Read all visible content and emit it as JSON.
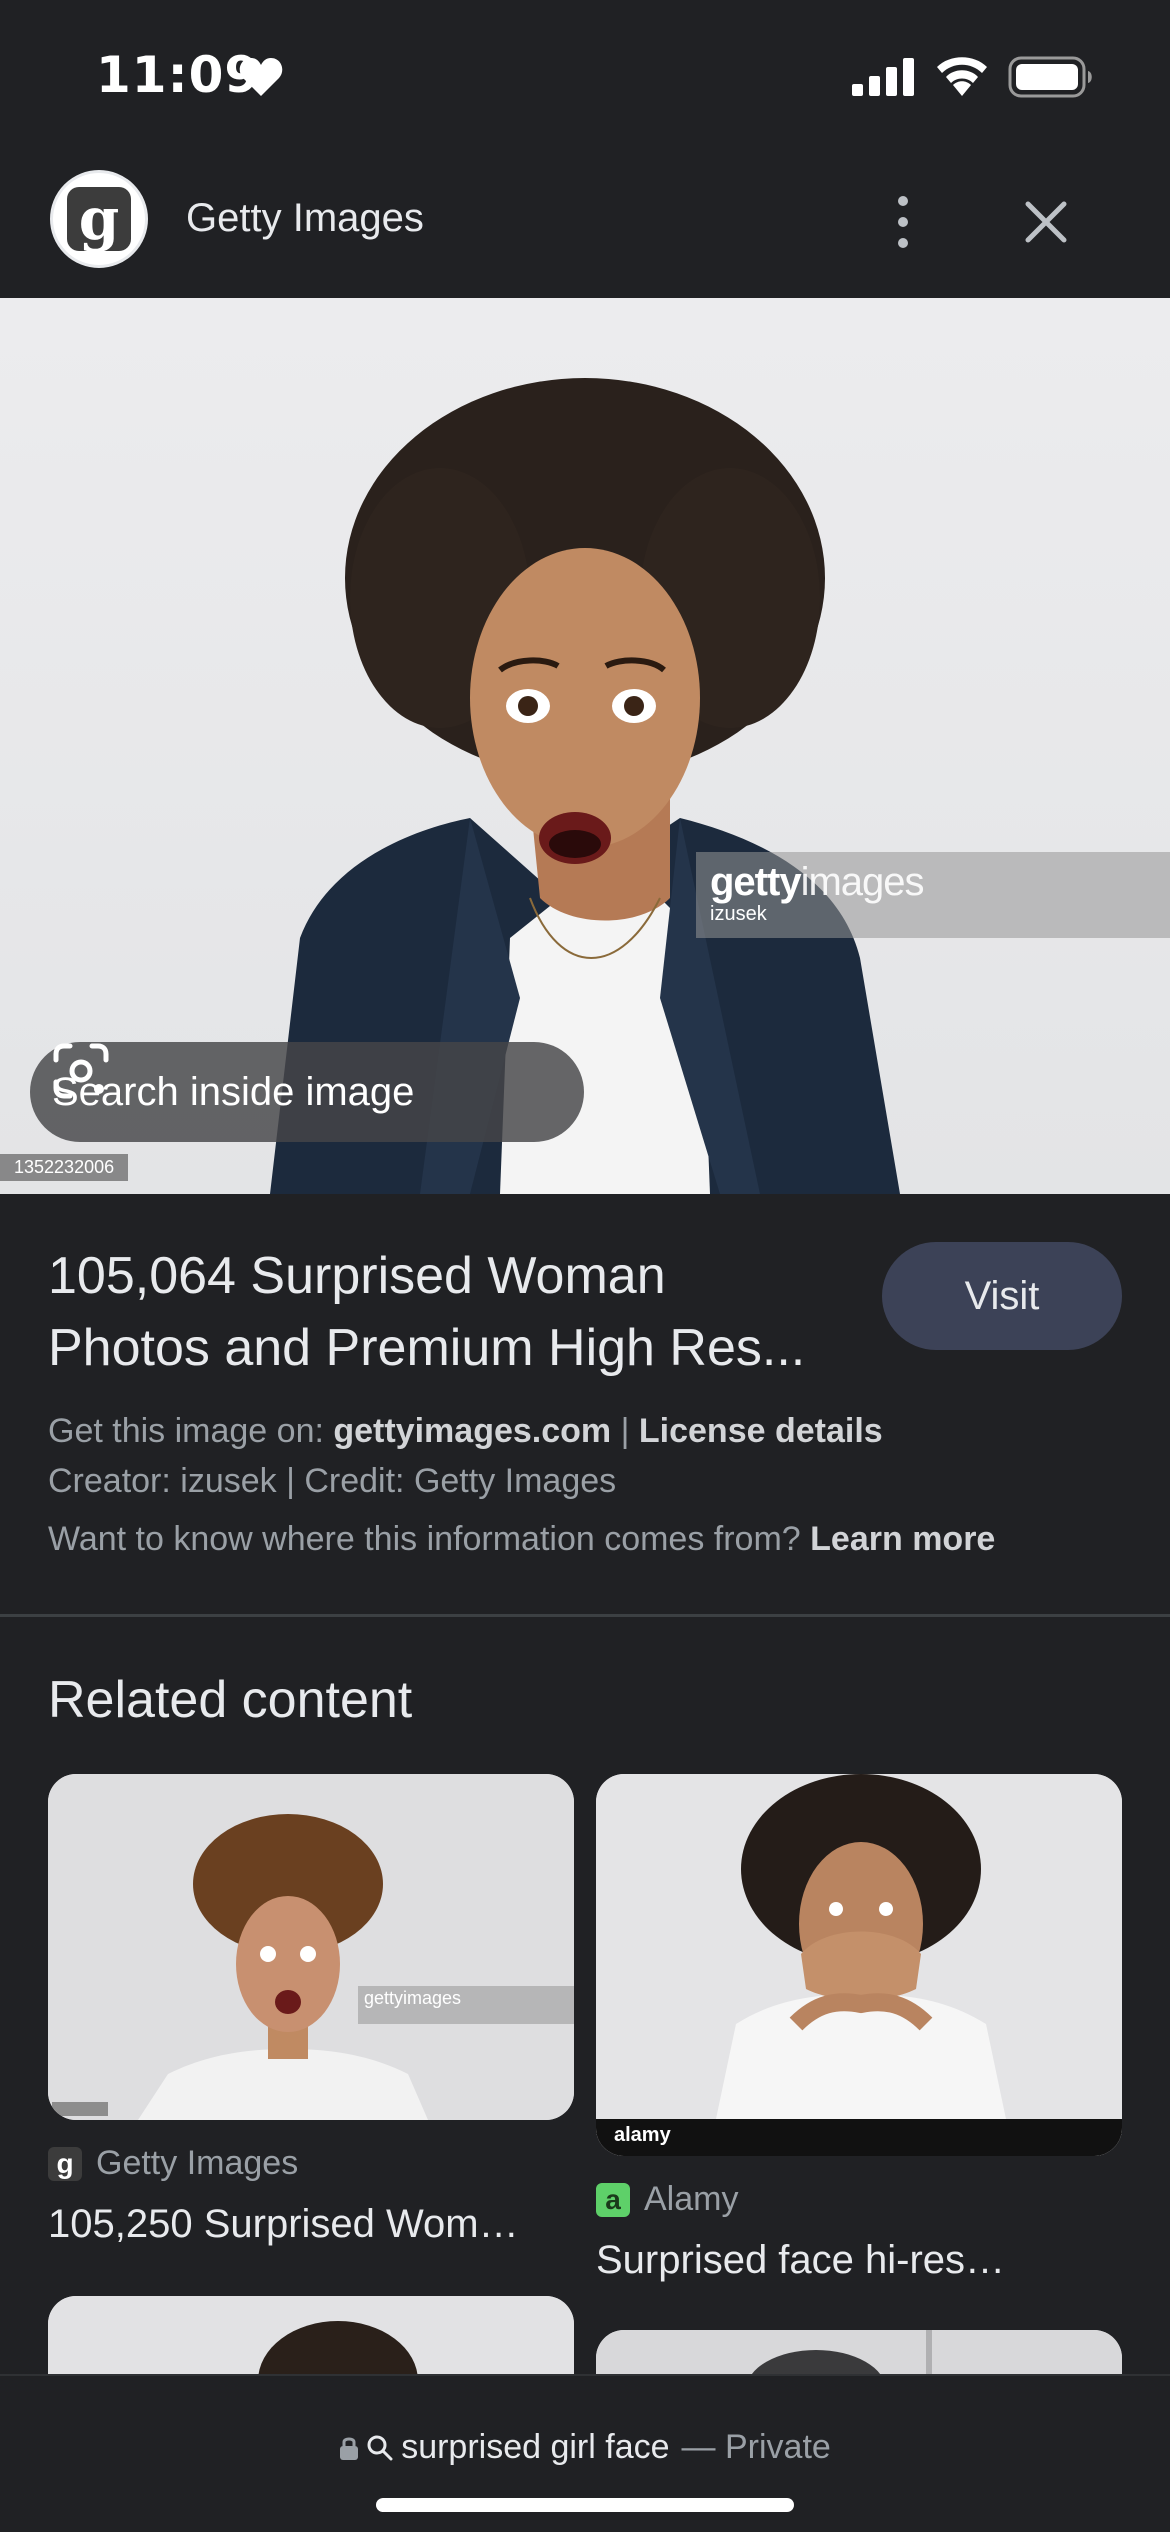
{
  "status_bar": {
    "time": "11:09"
  },
  "header": {
    "site_name": "Getty Images",
    "logo_letter": "g"
  },
  "hero": {
    "watermark_brand": "getty",
    "watermark_brand_suffix": "images",
    "watermark_creator": "izusek",
    "image_id": "1352232006",
    "search_inside_label": "Search inside image"
  },
  "result": {
    "title_line1": "105,064 Surprised Woman",
    "title_line2": "Photos and Premium High Res...",
    "visit_label": "Visit",
    "get_image_prefix": "Get this image on:",
    "get_image_site": "gettyimages.com",
    "separator": "|",
    "license_label": "License details",
    "creator_line": "Creator: izusek | Credit: Getty Images",
    "info_question": "Want to know where this information comes from?",
    "learn_more_label": "Learn more"
  },
  "related": {
    "heading": "Related content",
    "cards": [
      {
        "source": "Getty Images",
        "source_letter": "g",
        "title": "105,250 Surprised Wom…",
        "watermark": "gettyimages"
      },
      {
        "source": "Alamy",
        "source_letter": "a",
        "title": "Surprised face hi-res…",
        "watermark": "alamy"
      }
    ]
  },
  "bottom_bar": {
    "query": "surprised girl face",
    "dash": "—",
    "mode": "Private"
  },
  "colors": {
    "background": "#202124",
    "visit_button": "#3c4257",
    "muted_text": "#9aa0a6",
    "alamy_green": "#5ed069"
  }
}
